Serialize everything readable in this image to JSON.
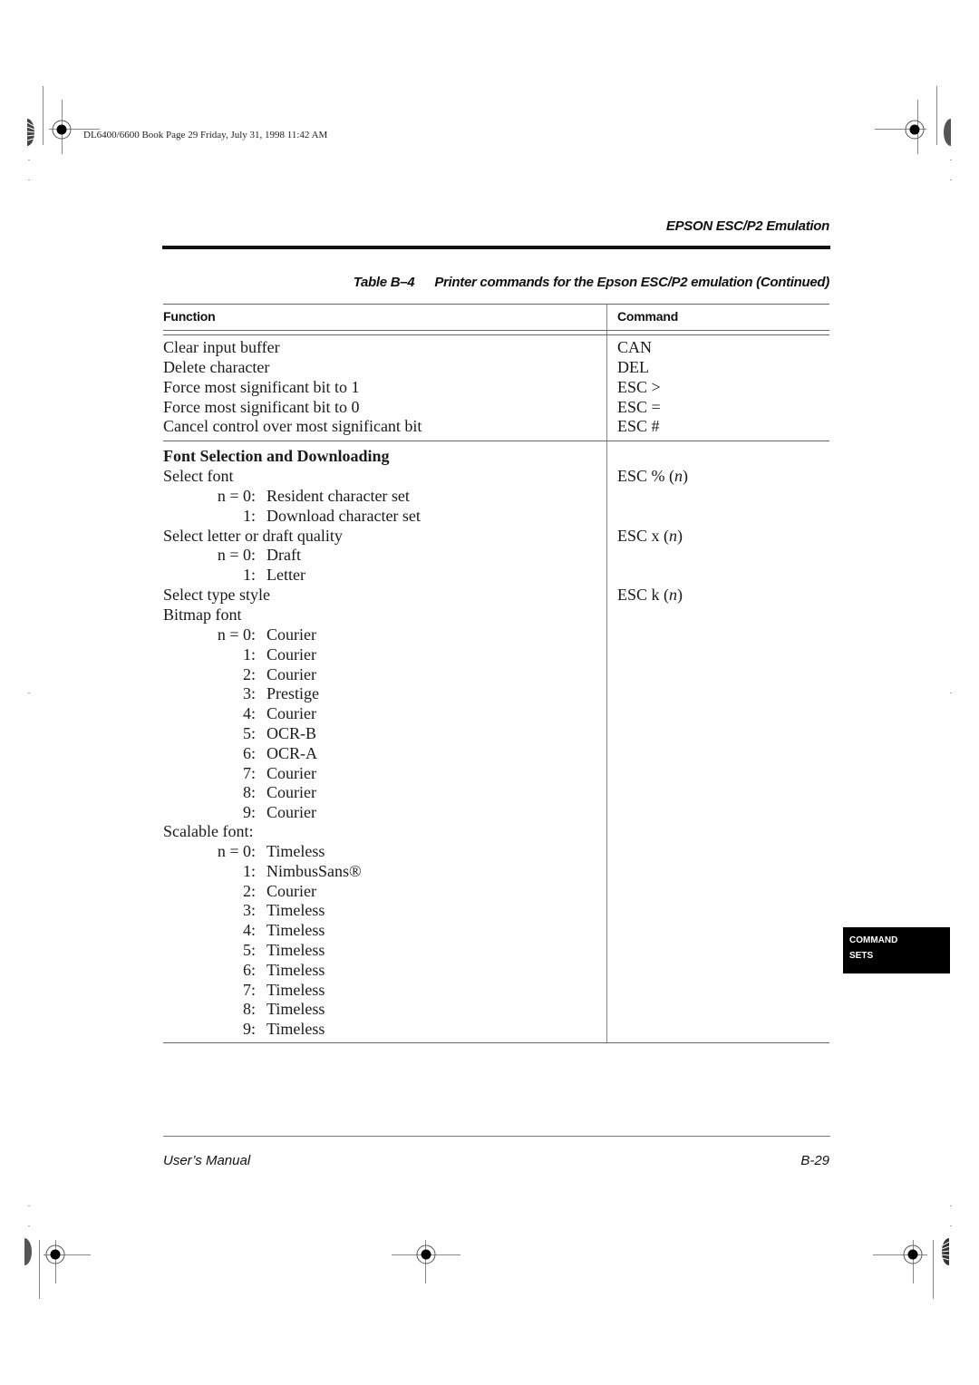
{
  "slug": "DL6400/6600 Book  Page 29  Friday, July 31, 1998  11:42 AM",
  "running_head": "EPSON ESC/P2 Emulation",
  "table": {
    "caption_number": "Table B–4",
    "caption_title": "Printer commands for the Epson ESC/P2 emulation (Continued)",
    "headers": {
      "function": "Function",
      "command": "Command"
    },
    "group1": [
      {
        "function": "Clear input buffer",
        "command": "CAN"
      },
      {
        "function": "Delete character",
        "command": "DEL"
      },
      {
        "function": "Force most significant bit to 1",
        "command": "ESC >"
      },
      {
        "function": "Force most significant bit to 0",
        "command": "ESC ="
      },
      {
        "function": "Cancel control over most significant bit",
        "command": "ESC #"
      }
    ],
    "group2": {
      "section_title": "Font Selection and Downloading",
      "select_font": {
        "label": "Select font",
        "command_prefix": "ESC % (",
        "command_param": "n",
        "command_suffix": ")",
        "options": [
          {
            "num": "n = 0:",
            "text": "Resident character set"
          },
          {
            "num": "1:",
            "text": "Download character set"
          }
        ]
      },
      "select_quality": {
        "label": "Select letter or draft quality",
        "command_prefix": "ESC x (",
        "command_param": "n",
        "command_suffix": ")",
        "options": [
          {
            "num": "n = 0:",
            "text": "Draft"
          },
          {
            "num": "1:",
            "text": "Letter"
          }
        ]
      },
      "select_type_style": {
        "label": "Select type style",
        "command_prefix": "ESC k (",
        "command_param": "n",
        "command_suffix": ")",
        "bitmap_label": "Bitmap font",
        "bitmap_options": [
          {
            "num": "n = 0:",
            "text": "Courier"
          },
          {
            "num": "1:",
            "text": "Courier"
          },
          {
            "num": "2:",
            "text": "Courier"
          },
          {
            "num": "3:",
            "text": "Prestige"
          },
          {
            "num": "4:",
            "text": "Courier"
          },
          {
            "num": "5:",
            "text": "OCR-B"
          },
          {
            "num": "6:",
            "text": "OCR-A"
          },
          {
            "num": "7:",
            "text": "Courier"
          },
          {
            "num": "8:",
            "text": "Courier"
          },
          {
            "num": "9:",
            "text": "Courier"
          }
        ],
        "scalable_label": "Scalable font:",
        "scalable_options": [
          {
            "num": "n = 0:",
            "text": "Timeless"
          },
          {
            "num": "1:",
            "text": "NimbusSans®"
          },
          {
            "num": "2:",
            "text": "Courier"
          },
          {
            "num": "3:",
            "text": "Timeless"
          },
          {
            "num": "4:",
            "text": "Timeless"
          },
          {
            "num": "5:",
            "text": "Timeless"
          },
          {
            "num": "6:",
            "text": "Timeless"
          },
          {
            "num": "7:",
            "text": "Timeless"
          },
          {
            "num": "8:",
            "text": "Timeless"
          },
          {
            "num": "9:",
            "text": "Timeless"
          }
        ]
      }
    }
  },
  "side_tab": {
    "line1": "COMMAND",
    "line2": "SETS"
  },
  "footer": {
    "left": "User’s Manual",
    "right": "B-29"
  }
}
